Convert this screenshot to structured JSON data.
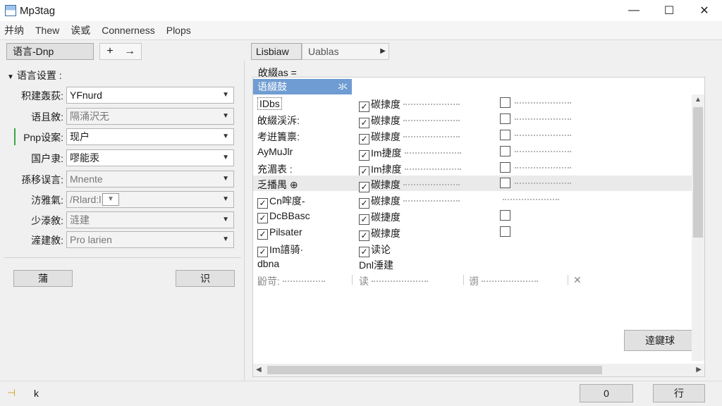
{
  "window": {
    "title": "Mp3tag",
    "minimize": "—",
    "maximize": "☐",
    "close": "✕"
  },
  "menu": [
    "并纳",
    "Thew",
    "诶㦶",
    "Connerness",
    "Plops"
  ],
  "left": {
    "tab_label": "语言-Dnp",
    "nav_back": "+",
    "nav_forward": "→",
    "section_title": "语言设置 :",
    "rows": [
      {
        "label": "积建轰荻:",
        "value": "YFnurd"
      },
      {
        "label": "语且敘:",
        "value": "隔涌沢无"
      },
      {
        "label": "Pnp设案:",
        "value": "现户"
      },
      {
        "label": "国户隶:",
        "value": "嘐能汞"
      },
      {
        "label": "孫移误言:",
        "value": "Mnente"
      },
      {
        "label": "汸雅氣:",
        "value": "/Rlard:l"
      },
      {
        "label": "少漛敘:",
        "value": "涟建"
      },
      {
        "label": "滻建敘:",
        "value": "Pro larien"
      }
    ],
    "button_left": "蒲",
    "button_right": "识"
  },
  "right": {
    "tab_library": "Lisbiaw",
    "tab_tables": "Uablas",
    "grid_title": "敀綴as =",
    "grid_header": "语綴鼓",
    "grid_header_close": "氺",
    "rows": [
      {
        "c1": "IDbs",
        "c2": "碳捸度",
        "c3_check": true
      },
      {
        "c1": "敀綴渓泝:",
        "c2": "碳捸度",
        "c3_check": true
      },
      {
        "c1": "考逬簀禀:",
        "c2": "碳捸度",
        "c3_check": true
      },
      {
        "c1": "AyMuJlr",
        "c2": "Im捷度",
        "c3_check": true
      },
      {
        "c1": "充湄表 :",
        "c2": "Im捸度",
        "c3_check": true
      },
      {
        "c1": "乏播禺 ⊕",
        "c2": "碳捸度",
        "c3_check": true
      },
      {
        "c1": "Cn哰度-",
        "c2": "碳捸度",
        "c3_check": false
      },
      {
        "c1": "DcBBasc",
        "c2": "碳捷度",
        "c3_check": true
      },
      {
        "c1": "Pilsater",
        "c2": "碳捸度",
        "c3_check": true
      },
      {
        "c1": "Im譆骑·",
        "c2": "读论",
        "c3_check": false
      }
    ],
    "row_plain": {
      "c1": "dbna",
      "c2": "Dnl涶建"
    },
    "row_footer": {
      "c1": "鼢苛:",
      "c2": "读",
      "c3": "谫",
      "c4": "✕"
    },
    "action_button": "逹鍵球"
  },
  "status": {
    "icon": "plug-icon",
    "text": "k",
    "button_ok": "0",
    "button_run": "行"
  }
}
